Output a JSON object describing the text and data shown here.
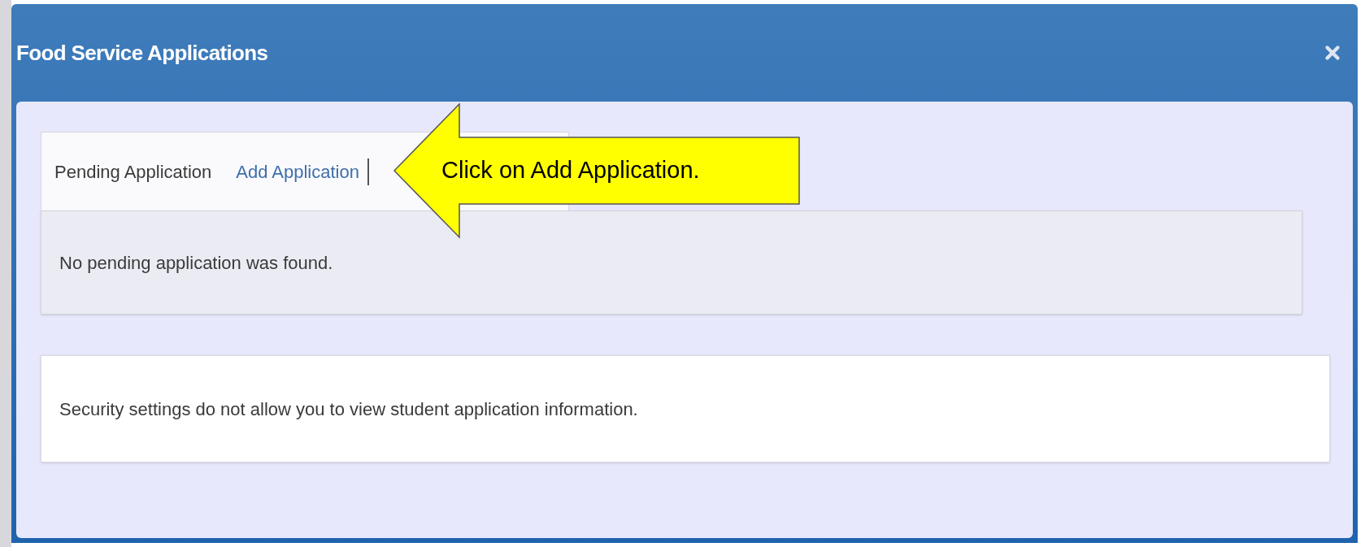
{
  "window": {
    "title": "Food Service Applications"
  },
  "tabs": [
    {
      "label": "Pending Application",
      "selected": true
    },
    {
      "label": "Add Application",
      "selected": false
    }
  ],
  "pending_panel": {
    "message": "No pending application was found."
  },
  "security_panel": {
    "message": "Security settings do not allow you to view student application information."
  },
  "callout": {
    "text": "Click on Add Application."
  }
}
